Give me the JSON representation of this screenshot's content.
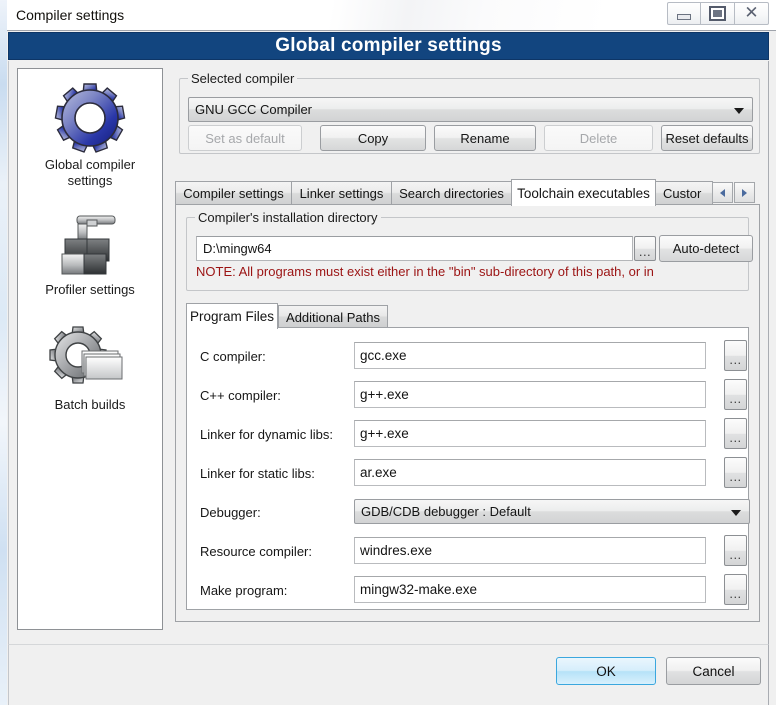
{
  "window": {
    "title": "Compiler settings",
    "controls": [
      {
        "name": "minimize-button",
        "icon": "minimize-icon"
      },
      {
        "name": "restore-button",
        "icon": "restore-icon"
      },
      {
        "name": "close-button",
        "icon": "close-icon"
      }
    ]
  },
  "header": {
    "title": "Global compiler settings",
    "background": "#12457f"
  },
  "sidebar": {
    "items": [
      {
        "label": "Global compiler settings",
        "icon": "blue-gear-icon",
        "selected": true
      },
      {
        "label": "Profiler settings",
        "icon": "profiler-icon",
        "selected": false
      },
      {
        "label": "Batch builds",
        "icon": "batch-build-icon",
        "selected": false
      }
    ]
  },
  "selected_compiler": {
    "group_title": "Selected compiler",
    "combo_value": "GNU GCC Compiler",
    "buttons": [
      {
        "label": "Set as default",
        "enabled": false
      },
      {
        "label": "Copy",
        "enabled": true
      },
      {
        "label": "Rename",
        "enabled": true
      },
      {
        "label": "Delete",
        "enabled": false
      },
      {
        "label": "Reset defaults",
        "enabled": true
      }
    ]
  },
  "tabs": {
    "items": [
      {
        "label": "Compiler settings",
        "active": false
      },
      {
        "label": "Linker settings",
        "active": false
      },
      {
        "label": "Search directories",
        "active": false
      },
      {
        "label": "Toolchain executables",
        "active": true
      },
      {
        "label": "Custor",
        "active": false
      }
    ],
    "nav_prev": "scroll-left-icon",
    "nav_next": "scroll-right-icon"
  },
  "install_dir": {
    "group_title": "Compiler's installation directory",
    "value": "D:\\mingw64",
    "browse_label": "...",
    "autodetect_label": "Auto-detect",
    "note": "NOTE: All programs must exist either in the \"bin\" sub-directory of this path, or in",
    "note_color": "#9b1313"
  },
  "inner_tabs": {
    "items": [
      {
        "label": "Program Files",
        "active": true
      },
      {
        "label": "Additional Paths",
        "active": false
      }
    ]
  },
  "program_files": {
    "fields": [
      {
        "label": "C compiler:",
        "value": "gcc.exe",
        "type": "text",
        "browse": "..."
      },
      {
        "label": "C++ compiler:",
        "value": "g++.exe",
        "type": "text",
        "browse": "..."
      },
      {
        "label": "Linker for dynamic libs:",
        "value": "g++.exe",
        "type": "text",
        "browse": "..."
      },
      {
        "label": "Linker for static libs:",
        "value": "ar.exe",
        "type": "text",
        "browse": "..."
      },
      {
        "label": "Debugger:",
        "value": "GDB/CDB debugger : Default",
        "type": "combo",
        "browse": ""
      },
      {
        "label": "Resource compiler:",
        "value": "windres.exe",
        "type": "text",
        "browse": "..."
      },
      {
        "label": "Make program:",
        "value": "mingw32-make.exe",
        "type": "text",
        "browse": "..."
      }
    ]
  },
  "footer": {
    "ok_label": "OK",
    "cancel_label": "Cancel"
  }
}
